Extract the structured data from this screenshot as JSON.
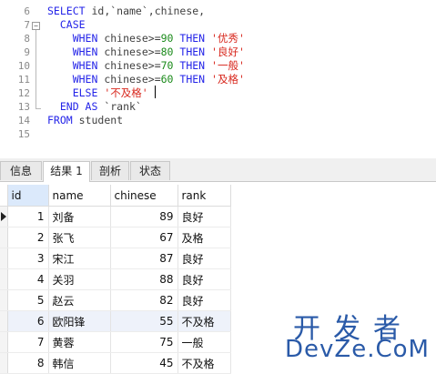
{
  "editor": {
    "lines": [
      {
        "n": "6",
        "tokens": [
          [
            "kw",
            "SELECT "
          ],
          [
            "id",
            "id,`name`,chinese,"
          ]
        ]
      },
      {
        "n": "7",
        "tokens": [
          [
            "kw",
            "  CASE"
          ]
        ]
      },
      {
        "n": "8",
        "tokens": [
          [
            "kw",
            "    WHEN "
          ],
          [
            "id",
            "chinese>="
          ],
          [
            "num",
            "90"
          ],
          [
            "kw",
            " THEN "
          ],
          [
            "str",
            "'优秀'"
          ]
        ]
      },
      {
        "n": "9",
        "tokens": [
          [
            "kw",
            "    WHEN "
          ],
          [
            "id",
            "chinese>="
          ],
          [
            "num",
            "80"
          ],
          [
            "kw",
            " THEN "
          ],
          [
            "str",
            "'良好'"
          ]
        ]
      },
      {
        "n": "10",
        "tokens": [
          [
            "kw",
            "    WHEN "
          ],
          [
            "id",
            "chinese>="
          ],
          [
            "num",
            "70"
          ],
          [
            "kw",
            " THEN "
          ],
          [
            "str",
            "'一般'"
          ]
        ]
      },
      {
        "n": "11",
        "tokens": [
          [
            "kw",
            "    WHEN "
          ],
          [
            "id",
            "chinese>="
          ],
          [
            "num",
            "60"
          ],
          [
            "kw",
            " THEN "
          ],
          [
            "str",
            "'及格'"
          ]
        ]
      },
      {
        "n": "12",
        "tokens": [
          [
            "kw",
            "    ELSE "
          ],
          [
            "str",
            "'不及格'"
          ]
        ]
      },
      {
        "n": "13",
        "tokens": [
          [
            "kw",
            "  END AS "
          ],
          [
            "id",
            "`rank`"
          ]
        ]
      },
      {
        "n": "14",
        "tokens": [
          [
            "kw",
            "FROM "
          ],
          [
            "id",
            "student"
          ]
        ]
      },
      {
        "n": "15",
        "tokens": []
      }
    ],
    "fold_symbol": "−"
  },
  "tabs": [
    {
      "label": "信息",
      "active": false
    },
    {
      "label": "结果 1",
      "active": true
    },
    {
      "label": "剖析",
      "active": false
    },
    {
      "label": "状态",
      "active": false
    }
  ],
  "grid": {
    "columns": [
      "id",
      "name",
      "chinese",
      "rank"
    ],
    "rows": [
      {
        "id": "1",
        "name": "刘备",
        "chinese": "89",
        "rank": "良好"
      },
      {
        "id": "2",
        "name": "张飞",
        "chinese": "67",
        "rank": "及格"
      },
      {
        "id": "3",
        "name": "宋江",
        "chinese": "87",
        "rank": "良好"
      },
      {
        "id": "4",
        "name": "关羽",
        "chinese": "88",
        "rank": "良好"
      },
      {
        "id": "5",
        "name": "赵云",
        "chinese": "82",
        "rank": "良好"
      },
      {
        "id": "6",
        "name": "欧阳锋",
        "chinese": "55",
        "rank": "不及格"
      },
      {
        "id": "7",
        "name": "黄蓉",
        "chinese": "75",
        "rank": "一般"
      },
      {
        "id": "8",
        "name": "韩信",
        "chinese": "45",
        "rank": "不及格"
      }
    ]
  },
  "watermark": {
    "line1": "开发者",
    "line2": "DevZe.CoM",
    "line3": ""
  },
  "colors": {
    "keyword": "#2424e8",
    "number": "#1a8a1a",
    "string": "#d8281e",
    "selected_header": "#dbe9fb",
    "alt_row": "#eef2fa",
    "watermark": "#2a5aa8"
  }
}
